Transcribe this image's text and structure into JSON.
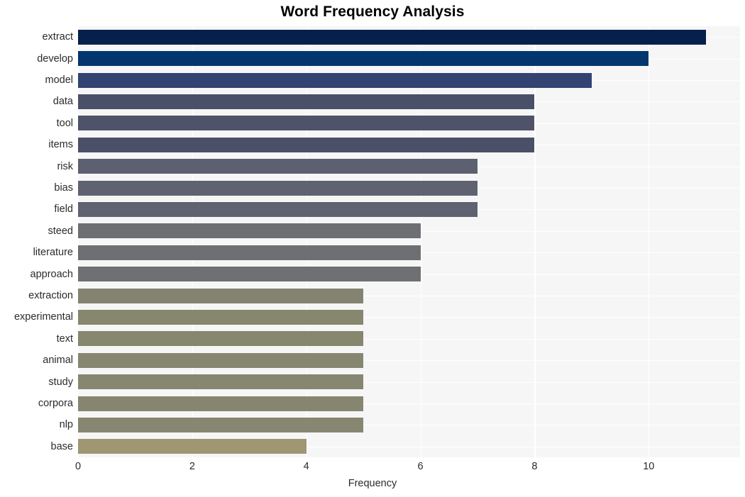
{
  "chart_data": {
    "type": "bar",
    "orientation": "horizontal",
    "title": "Word Frequency Analysis",
    "xlabel": "Frequency",
    "ylabel": "",
    "categories": [
      "extract",
      "develop",
      "model",
      "data",
      "tool",
      "items",
      "risk",
      "bias",
      "field",
      "steed",
      "literature",
      "approach",
      "extraction",
      "experimental",
      "text",
      "animal",
      "study",
      "corpora",
      "nlp",
      "base"
    ],
    "values": [
      11,
      10,
      9,
      8,
      8,
      8,
      7,
      7,
      7,
      6,
      6,
      6,
      5,
      5,
      5,
      5,
      5,
      5,
      5,
      4
    ],
    "bar_colors": [
      "#05204a",
      "#03366e",
      "#334473",
      "#4b5069",
      "#4e5369",
      "#4b5069",
      "#5d6070",
      "#5f6270",
      "#5f6270",
      "#6e6f72",
      "#6e6f72",
      "#6f7074",
      "#848371",
      "#87866f",
      "#87866f",
      "#878671",
      "#878671",
      "#868570",
      "#878671",
      "#9f9673"
    ],
    "xlim": [
      0,
      11.6
    ],
    "xticks": [
      0,
      2,
      4,
      6,
      8,
      10
    ],
    "xtick_labels": [
      "0",
      "2",
      "4",
      "6",
      "8",
      "10"
    ],
    "grid": true,
    "grid_color": "#ffffff",
    "plot_background": "#f6f6f6",
    "figure_background": "#ffffff",
    "legend": null
  }
}
